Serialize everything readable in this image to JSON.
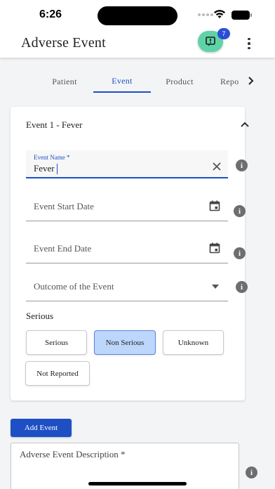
{
  "status_bar": {
    "time": "6:26"
  },
  "app_bar": {
    "title": "Adverse Event",
    "notification_count": "7"
  },
  "tabs": [
    {
      "label": "Patient",
      "active": false
    },
    {
      "label": "Event",
      "active": true
    },
    {
      "label": "Product",
      "active": false
    },
    {
      "label": "Repo",
      "active": false
    }
  ],
  "event_card": {
    "title": "Event 1 - Fever",
    "event_name": {
      "label": "Event Name *",
      "value": "Fever"
    },
    "start_date": {
      "placeholder": "Event Start Date"
    },
    "end_date": {
      "placeholder": "Event End Date"
    },
    "outcome": {
      "placeholder": "Outcome of the Event"
    },
    "serious": {
      "label": "Serious",
      "options": [
        "Serious",
        "Non Serious",
        "Unknown",
        "Not Reported"
      ],
      "selected": "Non Serious"
    }
  },
  "add_event_label": "Add Event",
  "description": {
    "label": "Adverse Event Description *"
  },
  "colors": {
    "primary": "#1f4fc4",
    "fab": "#5fd3a8",
    "selected_chip": "#bdd6fb"
  }
}
